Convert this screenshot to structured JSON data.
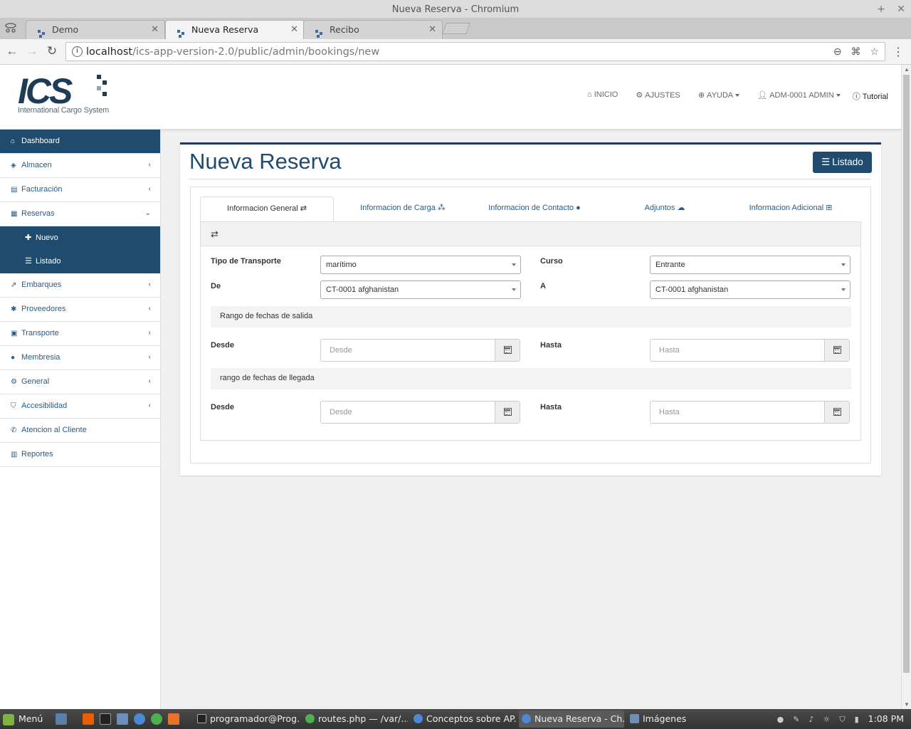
{
  "window": {
    "title": "Nueva Reserva - Chromium",
    "minimize_glyph": "+",
    "close_glyph": "✕"
  },
  "browser": {
    "tabs": [
      {
        "label": "Demo"
      },
      {
        "label": "Nueva Reserva"
      },
      {
        "label": "Recibo"
      }
    ],
    "tab_close_glyph": "✕",
    "url_host": "localhost",
    "url_path": "/ics-app-version-2.0/public/admin/bookings/new"
  },
  "app": {
    "logo_text": "ICS",
    "logo_subtitle": "International Cargo System",
    "nav": {
      "inicio": "INICIO",
      "ajustes": "AJUSTES",
      "ayuda": "AYUDA",
      "user": "ADM-0001 ADMIN",
      "tutorial": "Tutorial"
    }
  },
  "sidebar": {
    "items": [
      {
        "label": "Dashboard",
        "icon": "home-icon"
      },
      {
        "label": "Almacen",
        "icon": "cube-icon"
      },
      {
        "label": "Facturación",
        "icon": "file-icon"
      },
      {
        "label": "Reservas",
        "icon": "calendar-icon"
      },
      {
        "label": "Embarques",
        "icon": "external-link-icon"
      },
      {
        "label": "Proveedores",
        "icon": "asterisk-icon"
      },
      {
        "label": "Transporte",
        "icon": "bus-icon"
      },
      {
        "label": "Membresia",
        "icon": "user-icon"
      },
      {
        "label": "General",
        "icon": "cogs-icon"
      },
      {
        "label": "Accesibilidad",
        "icon": "shield-icon"
      },
      {
        "label": "Atencion al Cliente",
        "icon": "phone-icon"
      },
      {
        "label": "Reportes",
        "icon": "bar-chart-icon"
      }
    ],
    "reservas_sub": [
      {
        "label": "Nuevo",
        "icon": "plus-icon"
      },
      {
        "label": "Listado",
        "icon": "list-icon"
      }
    ]
  },
  "main": {
    "title": "Nueva Reserva",
    "listado_button": "Listado",
    "tabs": [
      {
        "label": "Informacion General",
        "icon": "exchange-icon"
      },
      {
        "label": "Informacion de Carga",
        "icon": "cubes-icon"
      },
      {
        "label": "Informacion de Contacto",
        "icon": "user-icon"
      },
      {
        "label": "Adjuntos",
        "icon": "cloud-upload-icon"
      },
      {
        "label": "Informacion Adicional",
        "icon": "plus-square-icon"
      }
    ],
    "form": {
      "tipo_transporte_label": "Tipo de Transporte",
      "tipo_transporte_value": "marítimo",
      "curso_label": "Curso",
      "curso_value": "Entrante",
      "de_label": "De",
      "de_value": "CT-0001 afghanistan",
      "a_label": "A",
      "a_value": "CT-0001 afghanistan",
      "salida_section": "Rango de fechas de salida",
      "llegada_section": "rango de fechas de llegada",
      "desde_label": "Desde",
      "hasta_label": "Hasta",
      "desde_placeholder": "Desde",
      "hasta_placeholder": "Hasta"
    }
  },
  "taskbar": {
    "menu_label": "Menú",
    "windows": [
      {
        "label": "programador@Prog..."
      },
      {
        "label": "routes.php — /var/..."
      },
      {
        "label": "Conceptos sobre AP..."
      },
      {
        "label": "Nueva Reserva - Ch..."
      },
      {
        "label": "Imágenes"
      }
    ],
    "clock": "1:08 PM"
  },
  "colors": {
    "brand": "#1f4b6e",
    "link": "#2a5b86",
    "title": "#1e4b72"
  }
}
